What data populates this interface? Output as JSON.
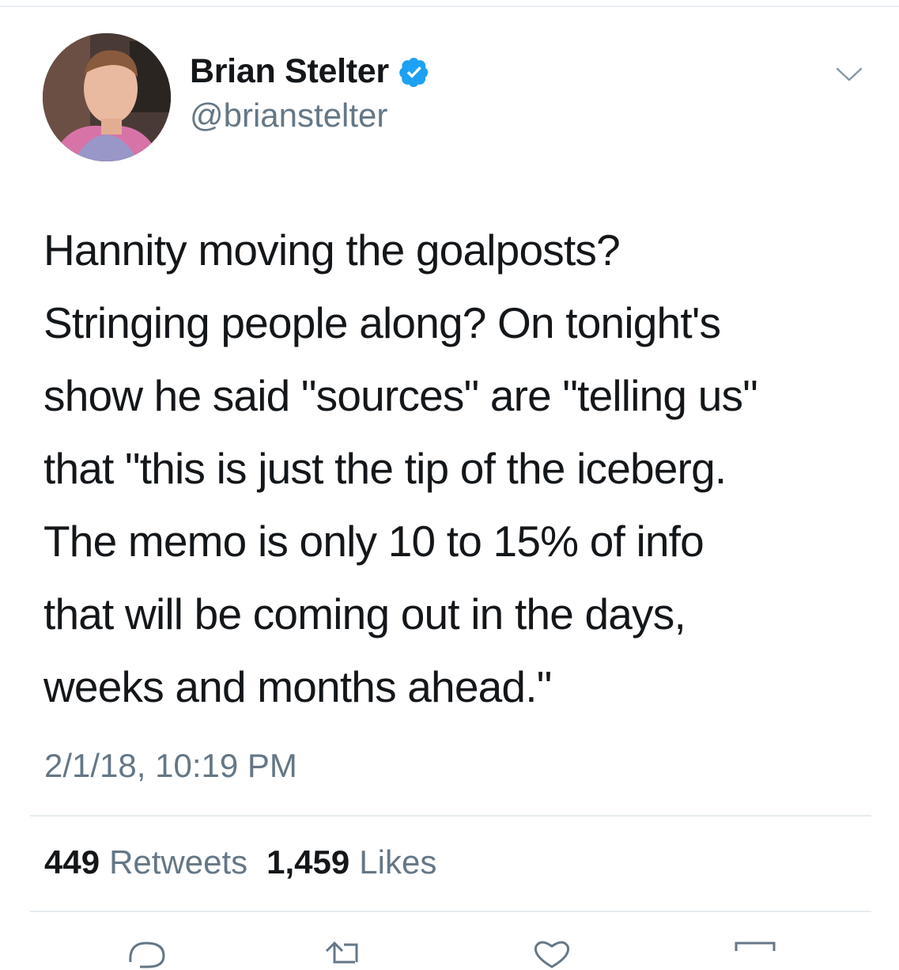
{
  "tweet": {
    "author": {
      "display_name": "Brian Stelter",
      "handle": "@brianstelter",
      "verified": true
    },
    "text_lines": [
      "Hannity moving the goalposts?",
      "Stringing people along? On tonight's",
      "show he said \"sources\" are \"telling us\"",
      "that \"this is just the tip of the iceberg.",
      "The memo is only 10 to 15% of info",
      "that will be coming out in the days,",
      "weeks and months ahead.\""
    ],
    "timestamp": "2/1/18, 10:19 PM",
    "stats": {
      "retweets_count": "449",
      "retweets_label": "Retweets",
      "likes_count": "1,459",
      "likes_label": "Likes"
    }
  },
  "icons": {
    "verified": "verified-badge-icon",
    "menu": "chevron-down-icon",
    "reply": "reply-icon",
    "retweet": "retweet-icon",
    "like": "heart-icon",
    "share": "share-icon"
  },
  "colors": {
    "text": "#14171a",
    "secondary_text": "#657786",
    "verified_blue": "#1da1f2",
    "divider": "#e6ecf0"
  }
}
